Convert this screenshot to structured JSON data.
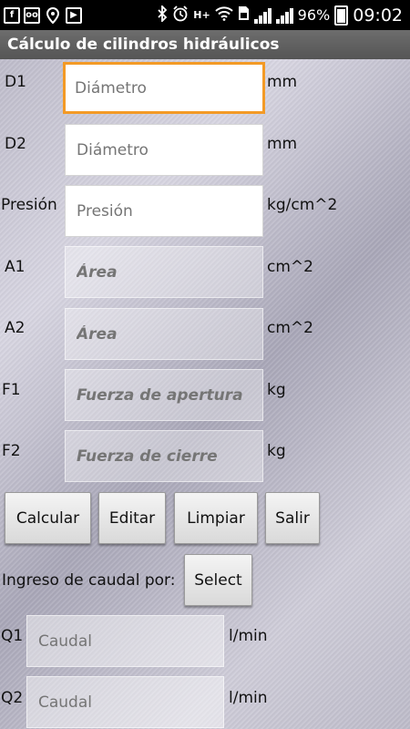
{
  "status_bar": {
    "battery_percent": "96%",
    "time": "09:02",
    "icons": [
      "facebook-icon",
      "voicemail-icon",
      "location-icon",
      "play-store-icon",
      "bluetooth-icon",
      "alarm-icon",
      "hplus-icon",
      "wifi-icon",
      "sim-icon",
      "signal-icon",
      "signal-icon",
      "battery-icon"
    ],
    "hplus_label": "H+"
  },
  "app": {
    "title": "Cálculo de cilindros hidráulicos"
  },
  "form": {
    "d1": {
      "label": "D1",
      "placeholder": "Diámetro",
      "unit": "mm"
    },
    "d2": {
      "label": "D2",
      "placeholder": "Diámetro",
      "unit": "mm"
    },
    "presion": {
      "label": "Presión",
      "placeholder": "Presión",
      "unit": "kg/cm^2"
    },
    "a1": {
      "label": "A1",
      "placeholder": "Área",
      "unit": "cm^2"
    },
    "a2": {
      "label": "A2",
      "placeholder": "Área",
      "unit": "cm^2"
    },
    "f1": {
      "label": "F1",
      "placeholder": "Fuerza de apertura",
      "unit": "kg"
    },
    "f2": {
      "label": "F2",
      "placeholder": "Fuerza de cierre",
      "unit": "kg"
    }
  },
  "buttons": {
    "calcular": "Calcular",
    "editar": "Editar",
    "limpiar": "Limpiar",
    "salir": "Salir"
  },
  "caudal": {
    "prompt": "Ingreso de caudal por:",
    "select_label": "Select",
    "q1": {
      "label": "Q1",
      "placeholder": "Caudal",
      "unit": "l/min"
    },
    "q2": {
      "label": "Q2",
      "placeholder": "Caudal",
      "unit": "l/min"
    }
  }
}
